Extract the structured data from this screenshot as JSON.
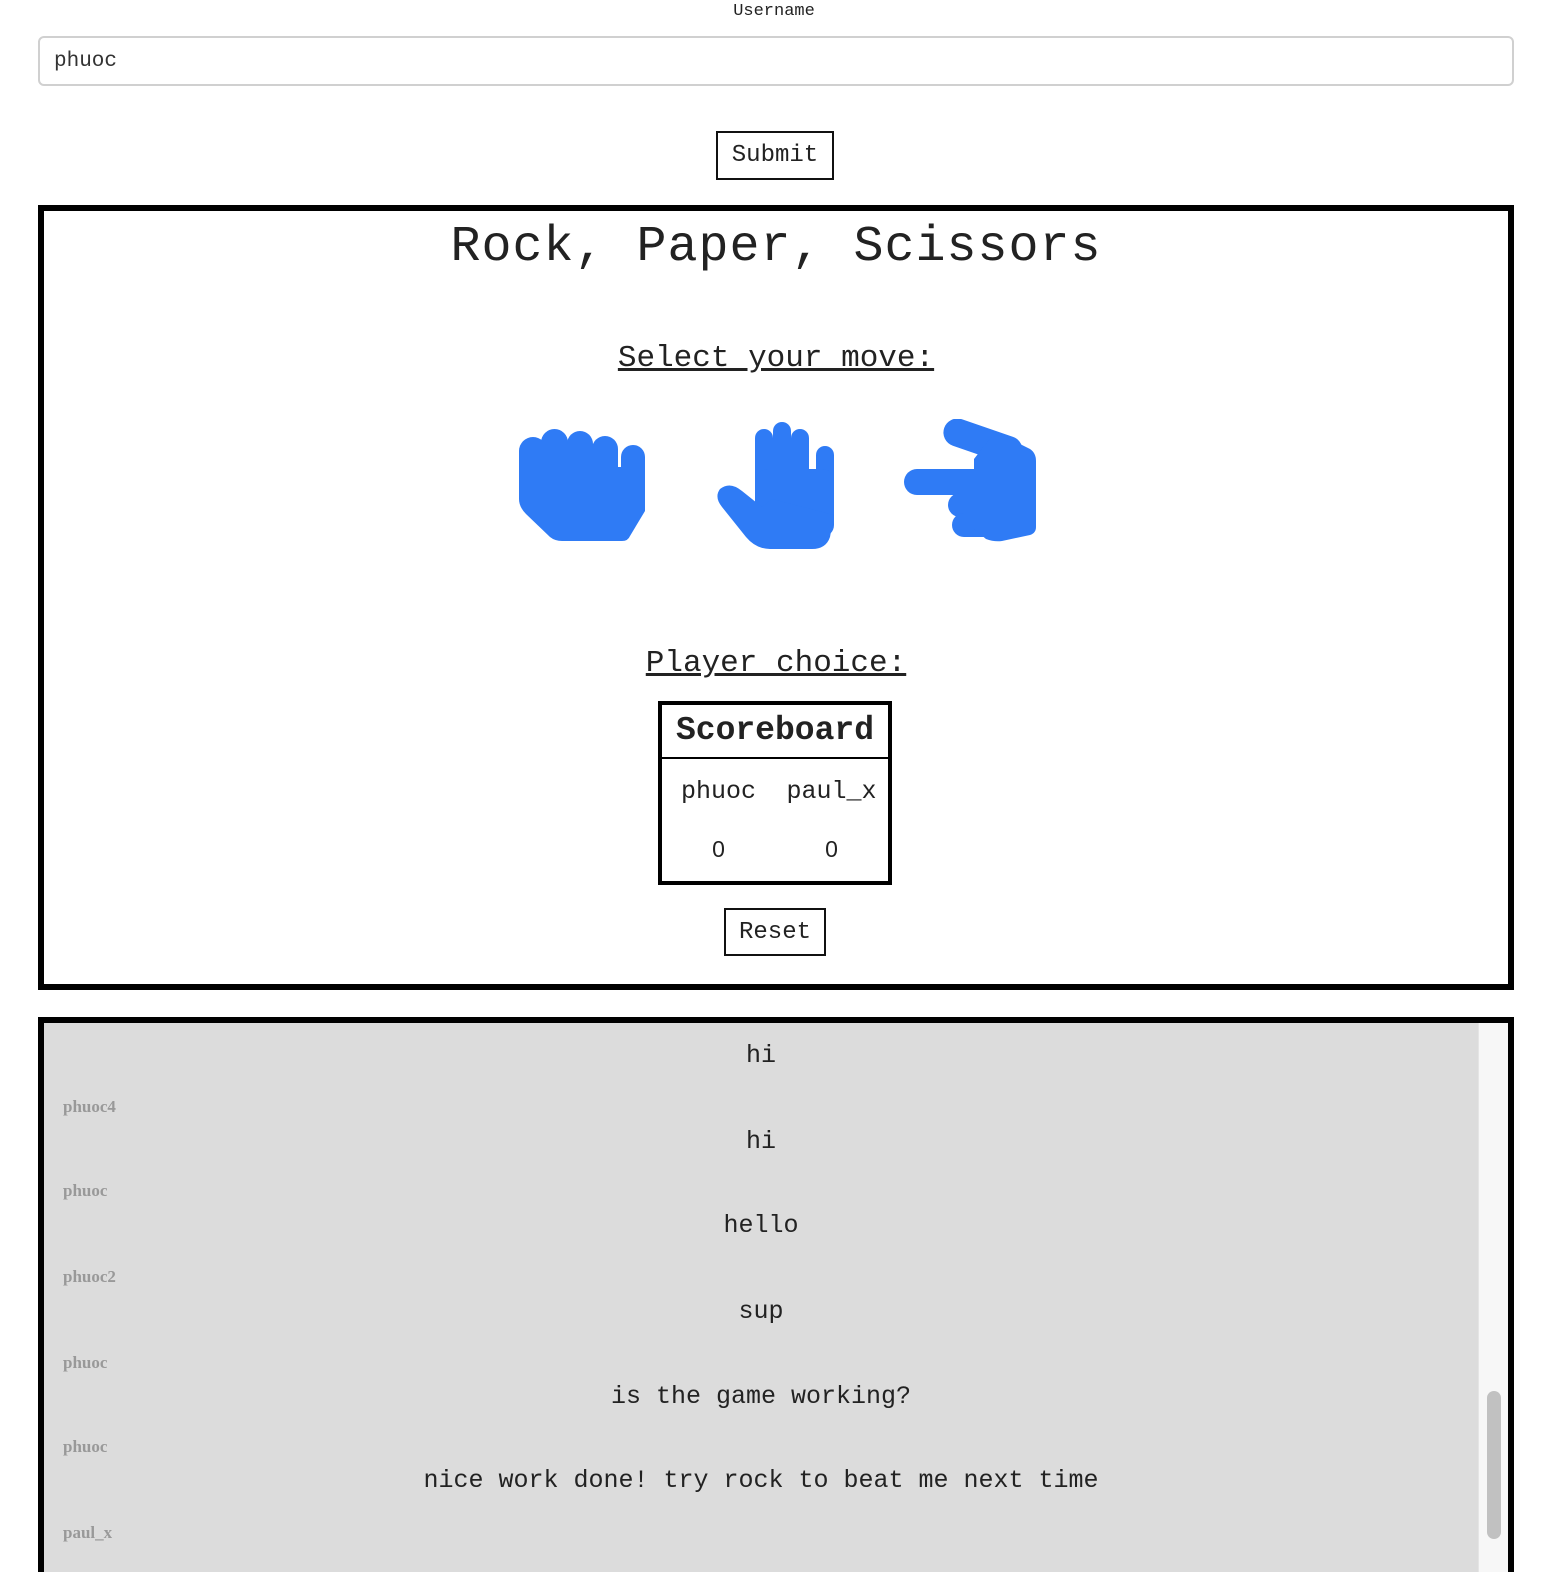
{
  "form": {
    "label": "Username",
    "value": "phuoc",
    "submit_label": "Submit"
  },
  "game": {
    "title": "Rock, Paper, Scissors",
    "select_heading": "Select your move:",
    "moves": [
      {
        "name": "rock",
        "icon": "hand-rock-icon",
        "color": "#2f7bf5"
      },
      {
        "name": "paper",
        "icon": "hand-paper-icon",
        "color": "#2f7bf5"
      },
      {
        "name": "scissors",
        "icon": "hand-scissors-icon",
        "color": "#2f7bf5"
      }
    ],
    "player_choice_label": "Player choice:",
    "scoreboard": {
      "title": "Scoreboard",
      "players": [
        {
          "name": "phuoc",
          "score": "0"
        },
        {
          "name": "paul_x",
          "score": "0"
        }
      ]
    },
    "reset_label": "Reset"
  },
  "chat": {
    "messages": [
      {
        "text": "hi",
        "user": "phuoc4"
      },
      {
        "text": "hi",
        "user": "phuoc"
      },
      {
        "text": "hello",
        "user": "phuoc2"
      },
      {
        "text": "sup",
        "user": "phuoc"
      },
      {
        "text": "is the game working?",
        "user": "phuoc"
      },
      {
        "text": "nice work done! try rock to beat me next time",
        "user": "paul_x"
      }
    ]
  }
}
